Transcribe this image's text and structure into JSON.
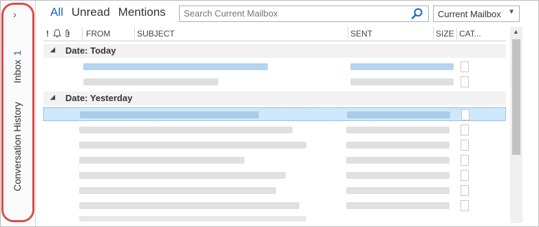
{
  "folder_pane": {
    "expand_glyph": "›",
    "inbox_label": "Inbox",
    "inbox_count": "1",
    "conversation_history_label": "Conversation History"
  },
  "filters": {
    "all": "All",
    "unread": "Unread",
    "mentions": "Mentions"
  },
  "search": {
    "placeholder": "Search Current Mailbox",
    "scope": "Current Mailbox"
  },
  "columns": {
    "importance": "!",
    "reminder_icon": "bell-icon",
    "attachment_icon": "paperclip-icon",
    "from": "FROM",
    "subject": "SUBJECT",
    "sent": "SENT",
    "size": "SIZE",
    "categories": "CAT..."
  },
  "groups": {
    "today": "Date: Today",
    "yesterday": "Date: Yesterday"
  },
  "colors": {
    "accent": "#1e62b4",
    "selection": "#cde8fb",
    "highlight_outline": "#dc4a4a"
  }
}
